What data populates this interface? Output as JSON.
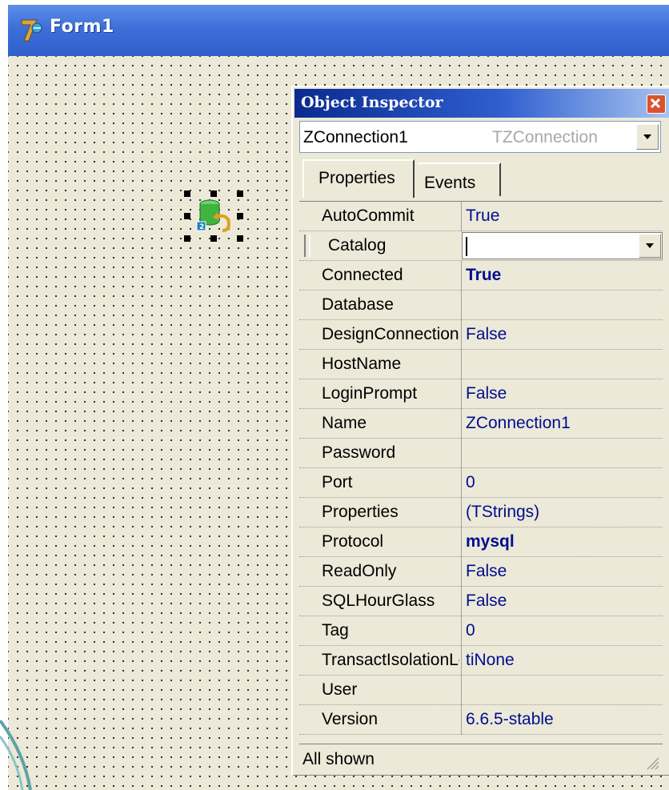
{
  "form": {
    "title": "Form1",
    "icon": "delphi-app-icon",
    "component_icon": "zconnection-database-icon"
  },
  "inspector": {
    "title": "Object Inspector",
    "close_icon": "close-icon",
    "selector": {
      "name": "ZConnection1",
      "type": "TZConnection"
    },
    "tabs": [
      {
        "label": "Properties",
        "active": true
      },
      {
        "label": "Events",
        "active": false
      }
    ],
    "properties": [
      {
        "name": "AutoCommit",
        "value": "True"
      },
      {
        "name": "Catalog",
        "value": ""
      },
      {
        "name": "Connected",
        "value": "True"
      },
      {
        "name": "Database",
        "value": ""
      },
      {
        "name": "DesignConnection",
        "value": "False"
      },
      {
        "name": "HostName",
        "value": ""
      },
      {
        "name": "LoginPrompt",
        "value": "False"
      },
      {
        "name": "Name",
        "value": "ZConnection1"
      },
      {
        "name": "Password",
        "value": ""
      },
      {
        "name": "Port",
        "value": "0"
      },
      {
        "name": "Properties",
        "value": "(TStrings)"
      },
      {
        "name": "Protocol",
        "value": "mysql"
      },
      {
        "name": "ReadOnly",
        "value": "False"
      },
      {
        "name": "SQLHourGlass",
        "value": "False"
      },
      {
        "name": "Tag",
        "value": "0"
      },
      {
        "name": "TransactIsolationLevel",
        "value": "tiNone"
      },
      {
        "name": "User",
        "value": ""
      },
      {
        "name": "Version",
        "value": "6.6.5-stable"
      }
    ],
    "status": "All shown"
  },
  "colors": {
    "titlebar": "#3d6fd9",
    "inspector_titlebar": "#0a2a8e",
    "value_text": "#000e8f",
    "panel": "#ece9d8"
  }
}
